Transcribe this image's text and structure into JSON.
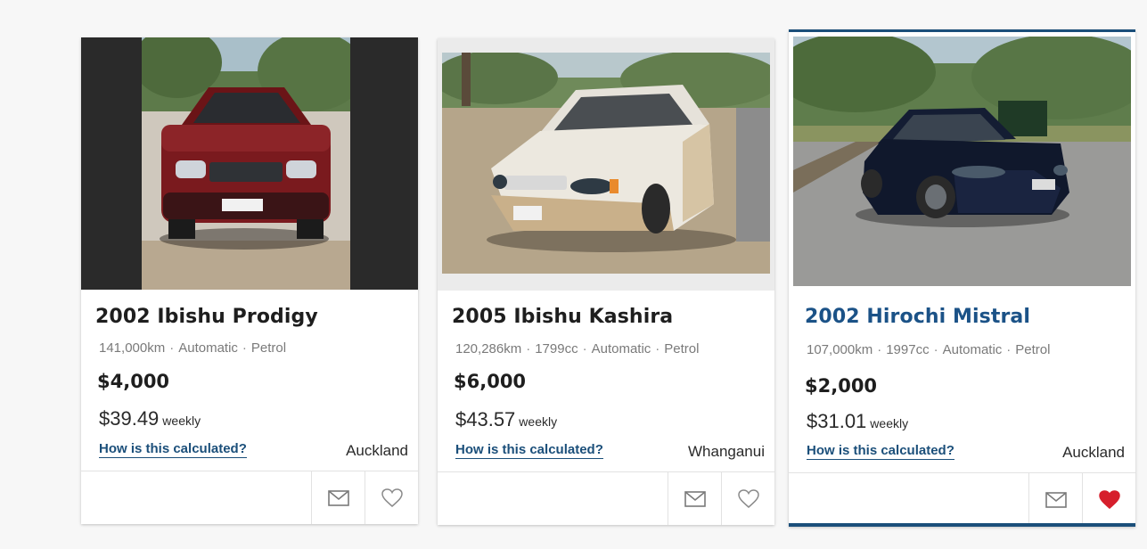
{
  "listings": [
    {
      "title": "2002 Ibishu Prodigy",
      "specs": [
        "141,000km",
        "Automatic",
        "Petrol"
      ],
      "price": "$4,000",
      "weekly_amount": "$39.49",
      "weekly_unit": "weekly",
      "calc_link": "How is this calculated?",
      "location": "Auckland",
      "car_color": "#7a1a1e",
      "favorited": false
    },
    {
      "title": "2005 Ibishu Kashira",
      "specs": [
        "120,286km",
        "1799cc",
        "Automatic",
        "Petrol"
      ],
      "price": "$6,000",
      "weekly_amount": "$43.57",
      "weekly_unit": "weekly",
      "calc_link": "How is this calculated?",
      "location": "Whanganui",
      "car_color": "#e8e4dc",
      "favorited": false
    },
    {
      "title": "2002 Hirochi Mistral",
      "specs": [
        "107,000km",
        "1997cc",
        "Automatic",
        "Petrol"
      ],
      "price": "$2,000",
      "weekly_amount": "$31.01",
      "weekly_unit": "weekly",
      "calc_link": "How is this calculated?",
      "location": "Auckland",
      "car_color": "#10182c",
      "favorited": true
    }
  ],
  "icons": {
    "mail": "mail-icon",
    "favorite": "heart-icon"
  },
  "colors": {
    "accent": "#1b4f7a",
    "heart_active": "#d61f2c",
    "heart_inactive": "#8a8a8a"
  }
}
